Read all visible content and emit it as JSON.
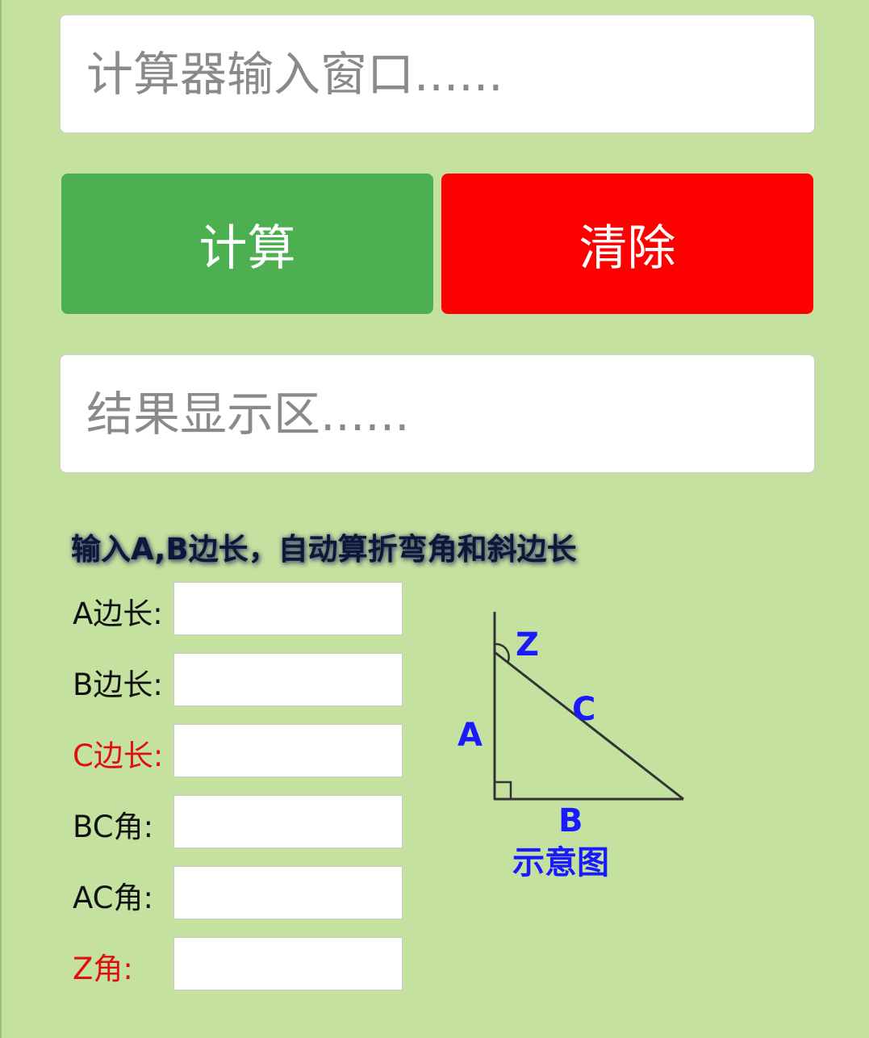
{
  "calculator": {
    "input_placeholder": "计算器输入窗口......",
    "compute_label": "计算",
    "clear_label": "清除",
    "result_placeholder": "结果显示区......"
  },
  "colors": {
    "background": "#c5e1a0",
    "compute_button": "#4caf50",
    "clear_button": "#ff0000",
    "diagram_text": "#1a1aff",
    "red_label": "#e01010"
  },
  "triangle_tool": {
    "hint": "输入A,B边长，自动算折弯角和斜边长",
    "rows": [
      {
        "label": "A边长:",
        "value": ""
      },
      {
        "label": "B边长:",
        "value": ""
      },
      {
        "label": "C边长:",
        "value": ""
      },
      {
        "label": "BC角:",
        "value": ""
      },
      {
        "label": "AC角:",
        "value": ""
      },
      {
        "label": "Z角:",
        "value": ""
      }
    ],
    "diagram": {
      "label_a": "A",
      "label_b": "B",
      "label_c": "C",
      "label_z": "Z",
      "caption": "示意图"
    }
  }
}
